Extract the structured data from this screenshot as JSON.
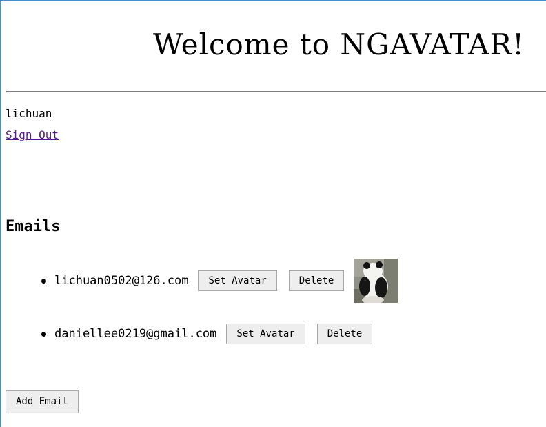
{
  "header": {
    "title": "Welcome to NGAVATAR!"
  },
  "user": {
    "username": "lichuan",
    "sign_out_label": "Sign Out"
  },
  "emails_section": {
    "heading": "Emails",
    "items": [
      {
        "address": "lichuan0502@126.com",
        "set_avatar_label": "Set Avatar",
        "delete_label": "Delete",
        "has_avatar": true
      },
      {
        "address": "daniellee0219@gmail.com",
        "set_avatar_label": "Set Avatar",
        "delete_label": "Delete",
        "has_avatar": false
      }
    ],
    "add_email_label": "Add Email"
  },
  "colors": {
    "link_visited": "#551a8b",
    "divider": "#7d7d7d",
    "button_bg": "#eeeeee",
    "button_border": "#a9a9a9"
  },
  "icons": {
    "avatar": "panda-avatar-image"
  }
}
